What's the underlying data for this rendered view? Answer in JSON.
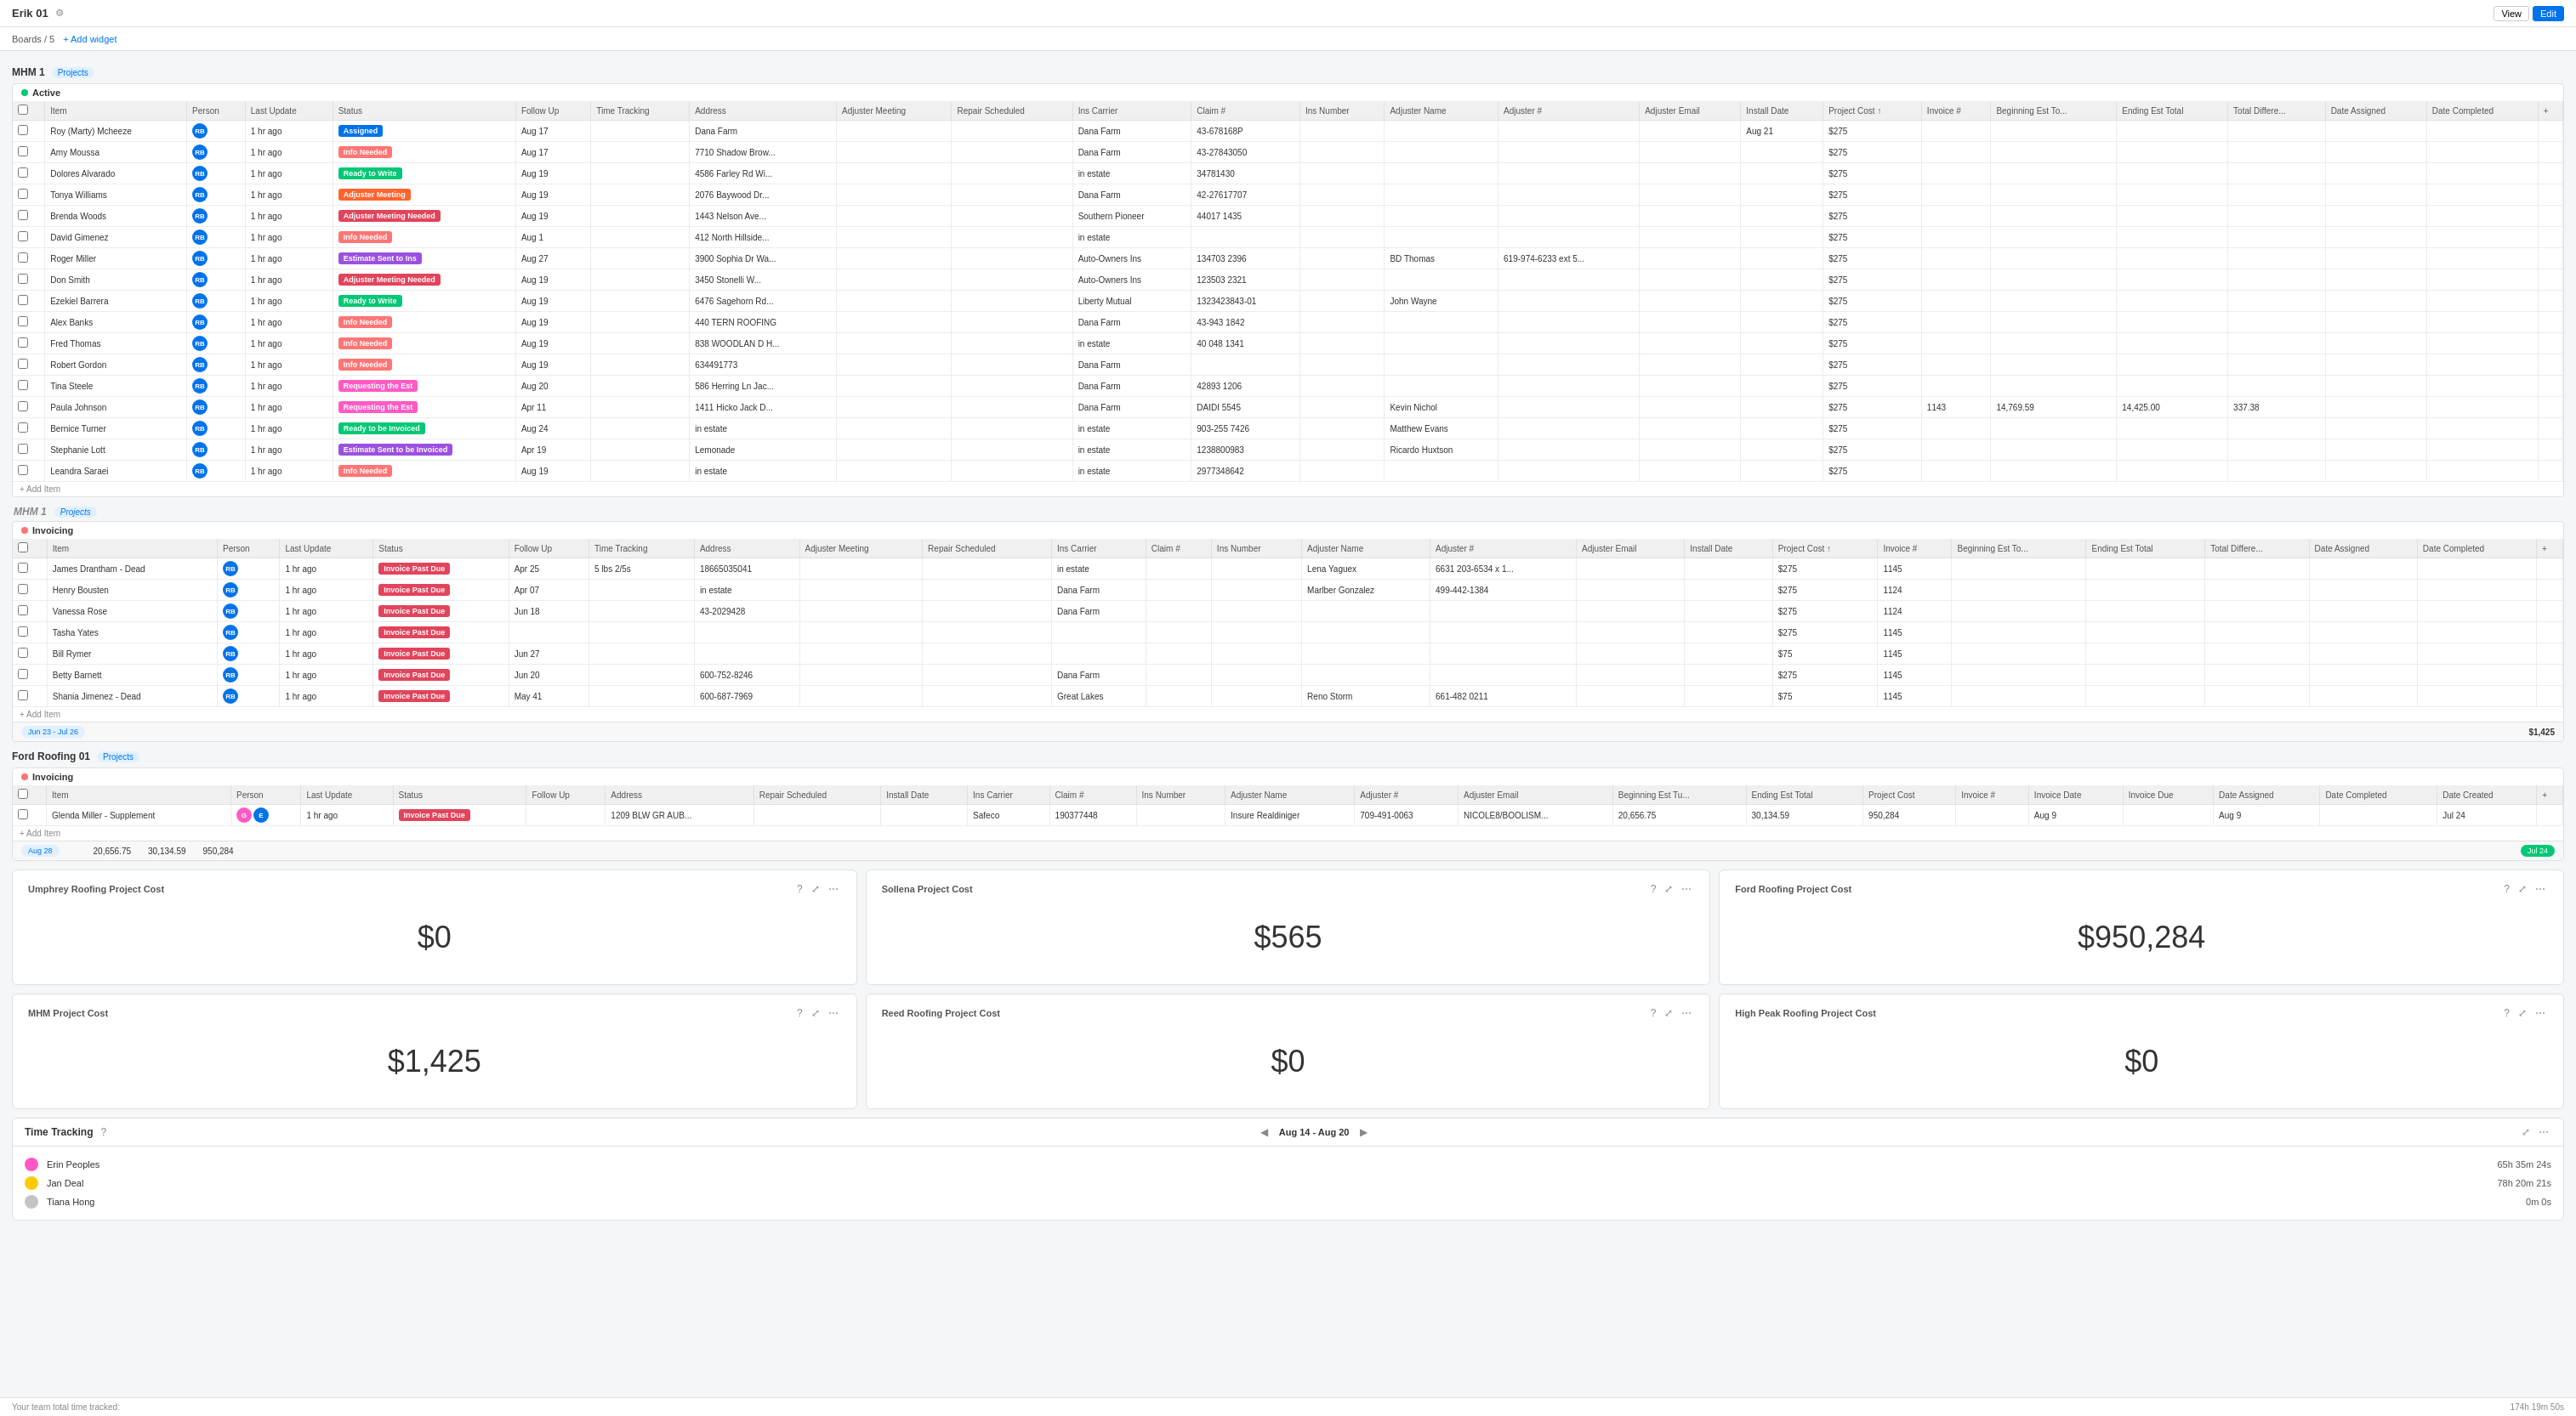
{
  "header": {
    "title": "Erik 01",
    "view_label": "View",
    "edit_label": "Edit"
  },
  "toolbar": {
    "boards_label": "Boards / 5",
    "add_widget_label": "+ Add widget"
  },
  "sections": [
    {
      "id": "mhm1",
      "label": "MHM 1",
      "badge": "Projects",
      "groups": [
        {
          "name": "Active",
          "color": "green",
          "rows": [
            {
              "item": "Roy (Marty) Mcheeze",
              "person": "RB",
              "status": "Assigned",
              "status_class": "status-assigned",
              "follow_up": "Aug 17",
              "address": "Dana Farm",
              "claim": "43-678168P",
              "ins_carrier": "Dana Farm",
              "project_cost": "$275",
              "install_date": "Aug 21"
            },
            {
              "item": "Amy Moussa",
              "person": "RB",
              "status": "Info Needed",
              "status_class": "status-info-needed",
              "follow_up": "Aug 17",
              "address": "7710 Shadow Brow...",
              "claim": "43-27843050",
              "ins_carrier": "Dana Farm",
              "project_cost": "$275"
            },
            {
              "item": "Dolores Alvarado",
              "person": "RB",
              "status": "Ready to Write",
              "status_class": "status-ready-write",
              "follow_up": "Aug 19",
              "address": "4586 Farley Rd Wi...",
              "claim": "34781430",
              "ins_carrier": "in estate",
              "project_cost": "$275"
            },
            {
              "item": "Tonya Williams",
              "person": "RB",
              "status": "Adjuster Meeting",
              "status_class": "status-adj-meeting",
              "follow_up": "Aug 19",
              "address": "2076 Baywood Dr...",
              "claim": "42-27617707",
              "ins_carrier": "Dana Farm",
              "project_cost": "$275"
            },
            {
              "item": "Brenda Woods",
              "person": "RB",
              "status": "Adjuster Meeting Needed",
              "status_class": "status-adj-meeting-needed",
              "follow_up": "Aug 19",
              "address": "1443 Nelson Ave...",
              "claim": "44017 1435",
              "ins_carrier": "Southern Pioneer",
              "project_cost": "$275"
            },
            {
              "item": "David Gimenez",
              "person": "RB",
              "status": "Info Needed",
              "status_class": "status-info-needed",
              "follow_up": "Aug 1",
              "address": "412 North Hillside...",
              "claim": "",
              "ins_carrier": "in estate",
              "project_cost": "$275"
            },
            {
              "item": "Roger Miller",
              "person": "RB",
              "status": "Estimate Sent to Ins",
              "status_class": "status-estimate-sent",
              "follow_up": "Aug 27",
              "address": "3900 Sophia Dr Wa...",
              "claim": "134703 2396",
              "ins_carrier": "Auto-Owners Ins",
              "adjuster_name": "BD Thomas",
              "adjuster_phone": "619-974-6233 ext 5...",
              "project_cost": "$275"
            },
            {
              "item": "Don Smith",
              "person": "RB",
              "status": "Adjuster Meeting Needed",
              "status_class": "status-adj-meeting-needed",
              "follow_up": "Aug 19",
              "address": "3450 Stonelli W...",
              "claim": "123503 2321",
              "ins_carrier": "Auto-Owners Ins",
              "project_cost": "$275"
            },
            {
              "item": "Ezekiel Barrera",
              "person": "RB",
              "status": "Ready to Write",
              "status_class": "status-ready-write",
              "follow_up": "Aug 19",
              "address": "6476 Sagehorn Rd...",
              "claim": "1323423843-01",
              "ins_carrier": "Liberty Mutual",
              "adjuster_name": "John Wayne",
              "project_cost": "$275"
            },
            {
              "item": "Alex Banks",
              "person": "RB",
              "status": "Info Needed",
              "status_class": "status-info-needed",
              "follow_up": "Aug 19",
              "address": "440 TERN ROOFING",
              "claim": "43-943 1842",
              "ins_carrier": "Dana Farm",
              "project_cost": "$275"
            },
            {
              "item": "Fred Thomas",
              "person": "RB",
              "status": "Info Needed",
              "status_class": "status-info-needed",
              "follow_up": "Aug 19",
              "address": "838 WOODLAN D H...",
              "claim": "40 048 1341",
              "ins_carrier": "in estate",
              "project_cost": "$275"
            },
            {
              "item": "Robert Gordon",
              "person": "RB",
              "status": "Info Needed",
              "status_class": "status-info-needed",
              "follow_up": "Aug 19",
              "address": "634491773",
              "claim": "",
              "ins_carrier": "Dana Farm",
              "project_cost": "$275"
            },
            {
              "item": "Tina Steele",
              "person": "RB",
              "status": "Requesting the Est",
              "status_class": "status-requesting",
              "follow_up": "Aug 20",
              "address": "586 Herring Ln Jac...",
              "claim": "42893 1206",
              "ins_carrier": "Dana Farm",
              "project_cost": "$275"
            },
            {
              "item": "Paula Johnson",
              "person": "RB",
              "status": "Requesting the Est",
              "status_class": "status-requesting",
              "follow_up": "Apr 11",
              "address": "1411 Hicko Jack D...",
              "claim": "DAIDI 5545",
              "ins_carrier": "Dana Farm",
              "adjuster_name": "Kevin Nichol",
              "project_cost": "$275",
              "invoice": "1143",
              "beg_est": "14,769.59",
              "end_est": "14,425.00",
              "total_diff": "337.38"
            },
            {
              "item": "Bernice Turner",
              "person": "RB",
              "status": "Ready to be Invoiced",
              "status_class": "status-ready-write",
              "follow_up": "Aug 24",
              "address": "in estate",
              "claim": "903-255 7426",
              "ins_carrier": "in estate",
              "adjuster_name": "Matthew Evans",
              "project_cost": "$275"
            },
            {
              "item": "Stephanie Lott",
              "person": "RB",
              "status": "Estimate Sent to be Invoiced",
              "status_class": "status-estimate-sent",
              "follow_up": "Apr 19",
              "address": "Lemonade",
              "claim": "1238800983",
              "ins_carrier": "in estate",
              "adjuster_name": "Ricardo Huxtson",
              "project_cost": "$275"
            },
            {
              "item": "Leandra Saraei",
              "person": "RB",
              "status": "Info Needed",
              "status_class": "status-info-needed",
              "follow_up": "Aug 19",
              "address": "in estate",
              "claim": "2977348642",
              "ins_carrier": "in estate",
              "project_cost": "$275"
            }
          ]
        }
      ]
    }
  ],
  "invoicing_section": {
    "id": "mhm1_inv",
    "label": "MHM 1",
    "badge": "Projects",
    "group_name": "Invoicing",
    "rows": [
      {
        "item": "James Drantham - Dead",
        "status": "Invoice Past Due",
        "follow_up": "Apr 25",
        "address": "18665035041",
        "ins_carrier": "in estate",
        "adjuster_name": "Lena Yaguex",
        "adjuster_phone": "6631 203-6534 x 1...",
        "project_cost": "$275",
        "invoice": "1145",
        "total_time": "5 lbs 2/5s"
      },
      {
        "item": "Henry Bousten",
        "status": "Invoice Past Due",
        "follow_up": "Apr 07",
        "address": "in estate",
        "ins_carrier": "Dana Farm",
        "adjuster_name": "Marlber Gonzalez",
        "adjuster_phone": "499-442-1384",
        "project_cost": "$275",
        "invoice": "1124"
      },
      {
        "item": "Vanessa Rose",
        "status": "Invoice Past Due",
        "follow_up": "Jun 18",
        "address": "43-2029428",
        "ins_carrier": "Dana Farm",
        "project_cost": "$275",
        "invoice": "1124"
      },
      {
        "item": "Tasha Yates",
        "status": "Invoice Past Due",
        "project_cost": "$275",
        "invoice": "1145"
      },
      {
        "item": "Bill Rymer",
        "status": "Invoice Past Due",
        "follow_up": "Jun 27",
        "project_cost": "$75",
        "invoice": "1145"
      },
      {
        "item": "Betty Barnett",
        "status": "Invoice Past Due",
        "follow_up": "Jun 20",
        "address": "600-752-8246",
        "ins_carrier": "Dana Farm",
        "project_cost": "$275",
        "invoice": "1145"
      },
      {
        "item": "Shania Jimenez - Dead",
        "status": "Invoice Past Due",
        "follow_up": "May 41",
        "address": "600-687-7969",
        "ins_carrier": "Great Lakes",
        "adjuster_name": "Reno Storm",
        "adjuster_phone": "661-482 0211",
        "project_cost": "$75",
        "invoice": "1145"
      }
    ],
    "totals": {
      "project_cost": "$1,425",
      "date_range": "Jun 23 - Jul 26"
    }
  },
  "ford_roofing": {
    "label": "Ford Roofing 01",
    "badge": "Projects",
    "group_name": "Invoicing",
    "rows": [
      {
        "item": "Glenda Miller - Supplement",
        "status": "Invoice Past Due",
        "address": "1209 BLW GR AUB...",
        "ins_carrier": "Safeco",
        "claim": "190377448",
        "adjuster_name": "Insure Realdiniger",
        "adjuster_phone": "709-491-0063",
        "adjuster_email": "NICOLE8/BOOLISM...",
        "beg_est": "20,656.75",
        "end_est": "30,134.59",
        "project_cost": "950,284"
      }
    ],
    "date_range": "Aug 28",
    "totals": {
      "beg_est": "20,656.75",
      "end_est": "30,134.59",
      "project_cost": "950,284",
      "invoice_date": "Jul 24"
    }
  },
  "widgets": [
    {
      "title": "Umphrey Roofing Project Cost",
      "value": "$0"
    },
    {
      "title": "Sollena Project Cost",
      "value": "$565"
    },
    {
      "title": "Ford Roofing Project Cost",
      "value": "$950,284"
    },
    {
      "title": "MHM Project Cost",
      "value": "$1,425"
    },
    {
      "title": "Reed Roofing Project Cost",
      "value": "$0"
    },
    {
      "title": "High Peak Roofing Project Cost",
      "value": "$0"
    }
  ],
  "time_tracking": {
    "title": "Time Tracking",
    "date_range": "Aug 14 - Aug 20",
    "entries": [
      {
        "name": "Erin Peoples",
        "color": "#ff5ac4",
        "time": "65h 35m 24s"
      },
      {
        "name": "Jan Deal",
        "color": "#ffcb00",
        "time": "78h 20m 21s"
      },
      {
        "name": "Tiana Hong",
        "color": "#c4c4c4",
        "time": "0m 0s"
      }
    ],
    "total": "174h 19m 50s"
  },
  "status_bar": {
    "team_label": "Your team total time tracked:"
  },
  "columns": {
    "active": [
      "",
      "Item",
      "Person",
      "Last Update",
      "Status",
      "Follow Up",
      "Time Tracking",
      "Address",
      "Adjuster Meeting",
      "Repair Scheduled",
      "Ins Carrier",
      "Claim #",
      "Ins Number",
      "Adjuster Name",
      "Adjuster #",
      "Adjuster Email",
      "Install Date",
      "Project Cost",
      "Invoice #",
      "Beginning Est To...",
      "Ending Est Total",
      "Total Differe...",
      "Date Assigned",
      "Date Completed",
      "+"
    ],
    "invoicing": [
      "",
      "Item",
      "Person",
      "Last Update",
      "Status",
      "Follow Up",
      "Time Tracking",
      "Address",
      "Adjuster Meeting",
      "Repair Scheduled",
      "Ins Carrier",
      "Claim #",
      "Ins Number",
      "Adjuster Name",
      "Adjuster #",
      "Adjuster Email",
      "Install Date",
      "Project Cost",
      "Invoice #",
      "Beginning Est To...",
      "Ending Est Total",
      "Total Differe...",
      "Date Assigned",
      "Date Completed",
      "+"
    ],
    "ford": [
      "",
      "Item",
      "Person",
      "Last Update",
      "Status",
      "Follow Up",
      "Address",
      "Repair Scheduled",
      "Install Date",
      "Ins Carrier",
      "Claim #",
      "Ins Number",
      "Adjuster Name",
      "Adjuster #",
      "Adjuster Email",
      "Beginning Est Tu...",
      "Ending Est Total",
      "Project Cost",
      "Invoice #",
      "Invoice Date",
      "Invoice Due",
      "Date Assigned",
      "Date Completed",
      "Date Created",
      "+"
    ]
  }
}
